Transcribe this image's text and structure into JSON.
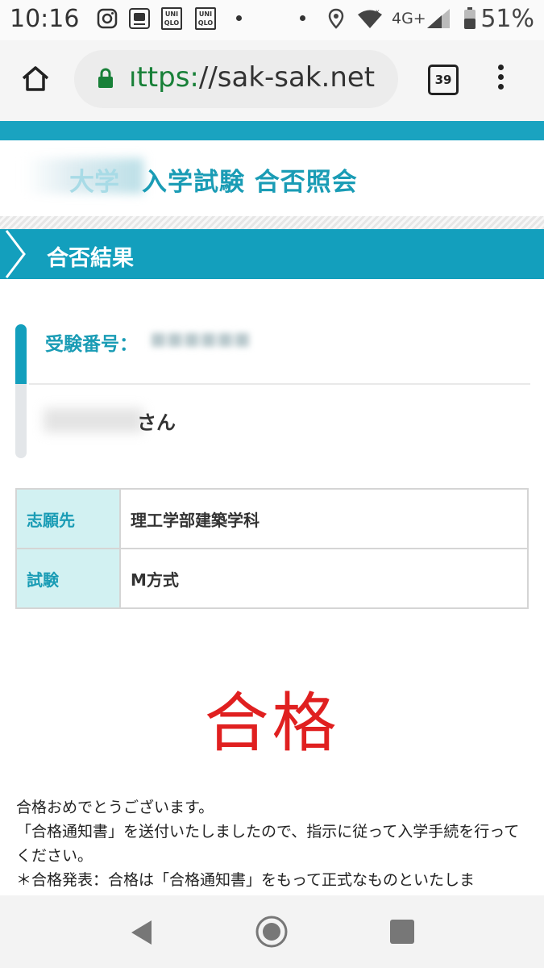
{
  "status_bar": {
    "time": "10:16",
    "network": "4G+",
    "battery": "51%",
    "uniqlo_1": "UNI QLO",
    "uniqlo_2": "UNI QLO"
  },
  "browser": {
    "url_scheme": "ıttps:",
    "url_rest": "//sak-sak.net",
    "tab_count": "39"
  },
  "header": {
    "title_blurred_part": "大学",
    "title": "入学試験 合否照会"
  },
  "section": {
    "title": "合否結果"
  },
  "exam_id": {
    "label": "受験番号："
  },
  "applicant": {
    "suffix": "さん"
  },
  "info_table": [
    {
      "key": "志願先",
      "value": "理工学部建築学科"
    },
    {
      "key": "試験",
      "value": "M方式"
    }
  ],
  "result": "合格",
  "message": [
    "合格おめでとうございます。",
    "「合格通知書」を送付いたしましたので、指示に従って入学手続を行ってください。",
    "＊合格発表：合格は「合格通知書」をもって正式なものといたしま"
  ],
  "colors": {
    "accent": "#139fbd",
    "result_red": "#e02020",
    "table_key_bg": "#d2f1f2"
  }
}
